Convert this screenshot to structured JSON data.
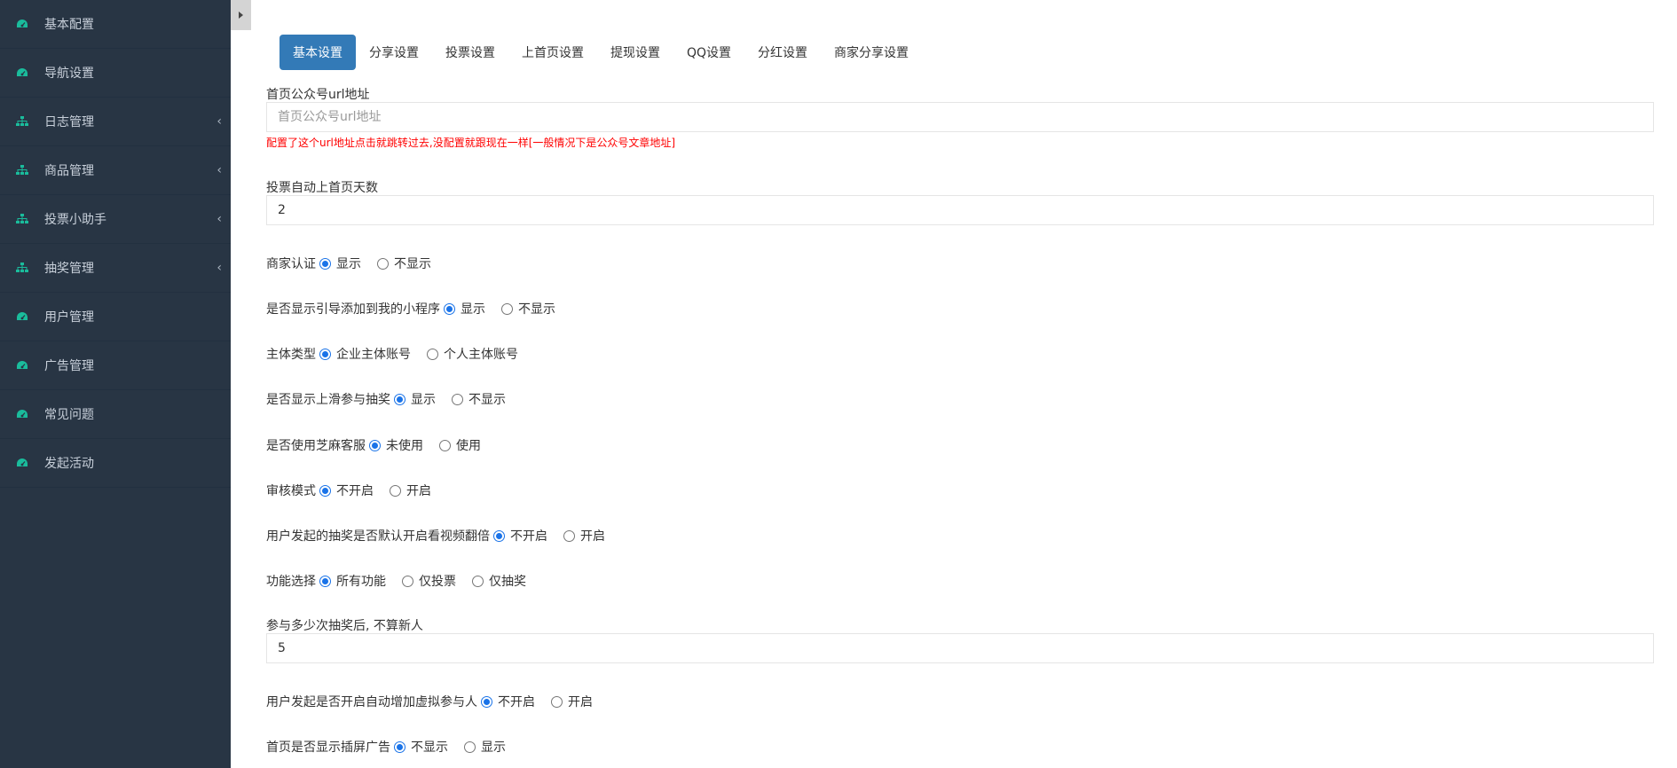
{
  "sidebar": {
    "items": [
      {
        "label": "基本配置",
        "icon": "dashboard-icon",
        "chevron": false
      },
      {
        "label": "导航设置",
        "icon": "dashboard-icon",
        "chevron": false
      },
      {
        "label": "日志管理",
        "icon": "sitemap-icon",
        "chevron": true
      },
      {
        "label": "商品管理",
        "icon": "sitemap-icon",
        "chevron": true
      },
      {
        "label": "投票小助手",
        "icon": "sitemap-icon",
        "chevron": true
      },
      {
        "label": "抽奖管理",
        "icon": "sitemap-icon",
        "chevron": true
      },
      {
        "label": "用户管理",
        "icon": "dashboard-icon",
        "chevron": false
      },
      {
        "label": "广告管理",
        "icon": "dashboard-icon",
        "chevron": false
      },
      {
        "label": "常见问题",
        "icon": "dashboard-icon",
        "chevron": false
      },
      {
        "label": "发起活动",
        "icon": "dashboard-icon",
        "chevron": false
      }
    ],
    "chevron_glyph": "‹",
    "icon_color": "#1abc9c"
  },
  "tabs": [
    "基本设置",
    "分享设置",
    "投票设置",
    "上首页设置",
    "提现设置",
    "QQ设置",
    "分红设置",
    "商家分享设置"
  ],
  "active_tab": "基本设置",
  "accent": "#337ab7",
  "form": {
    "url_label": "首页公众号url地址",
    "url_placeholder": "首页公众号url地址",
    "url_hint": "配置了这个url地址点击就跳转过去,没配置就跟现在一样[一般情况下是公众号文章地址]",
    "days_label": "投票自动上首页天数",
    "days_value": "2",
    "merchant": {
      "label": "商家认证",
      "opt1": "显示",
      "opt2": "不显示"
    },
    "guide": {
      "label": "是否显示引导添加到我的小程序",
      "opt1": "显示",
      "opt2": "不显示"
    },
    "entity": {
      "label": "主体类型",
      "opt1": "企业主体账号",
      "opt2": "个人主体账号"
    },
    "swipe": {
      "label": "是否显示上滑参与抽奖",
      "opt1": "显示",
      "opt2": "不显示"
    },
    "zhima": {
      "label": "是否使用芝麻客服",
      "opt1": "未使用",
      "opt2": "使用"
    },
    "audit": {
      "label": "审核模式",
      "opt1": "不开启",
      "opt2": "开启"
    },
    "video": {
      "label": "用户发起的抽奖是否默认开启看视频翻倍",
      "opt1": "不开启",
      "opt2": "开启"
    },
    "func": {
      "label": "功能选择",
      "opt1": "所有功能",
      "opt2": "仅投票",
      "opt3": "仅抽奖"
    },
    "count_label": "参与多少次抽奖后, 不算新人",
    "count_value": "5",
    "virtual": {
      "label": "用户发起是否开启自动增加虚拟参与人",
      "opt1": "不开启",
      "opt2": "开启"
    },
    "interstitial": {
      "label": "首页是否显示插屏广告",
      "opt1": "不显示",
      "opt2": "显示"
    }
  }
}
